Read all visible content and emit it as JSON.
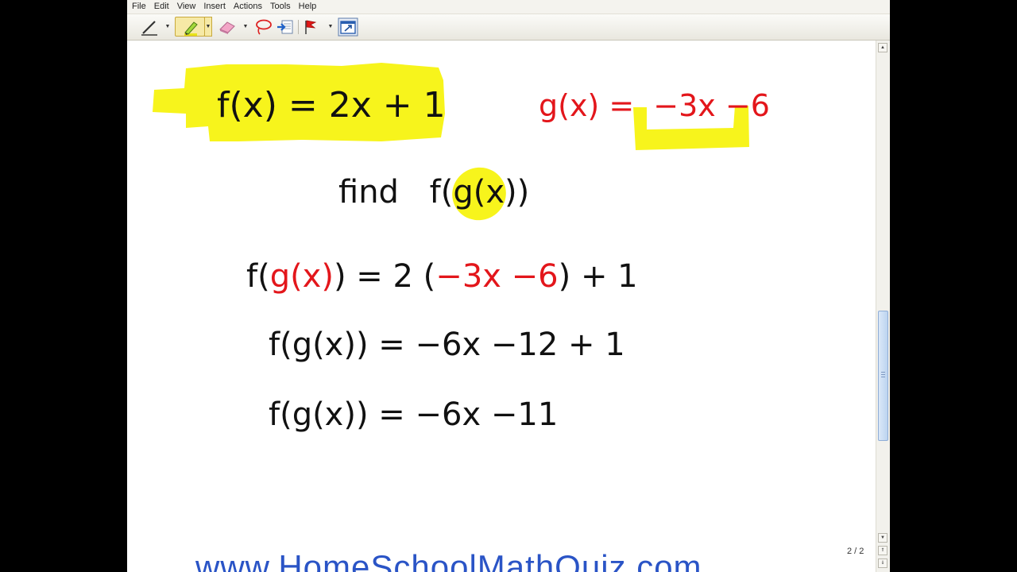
{
  "menu": {
    "items": [
      "File",
      "Edit",
      "View",
      "Insert",
      "Actions",
      "Tools",
      "Help"
    ]
  },
  "toolbar": {
    "tools": [
      {
        "name": "pen-tool",
        "icon": "pen-icon"
      },
      {
        "name": "highlighter-tool",
        "icon": "highlighter-icon",
        "selected": true
      },
      {
        "name": "eraser-tool",
        "icon": "eraser-icon"
      },
      {
        "name": "lasso-tool",
        "icon": "lasso-icon"
      },
      {
        "name": "insert-space-tool",
        "icon": "insert-space-icon"
      },
      {
        "name": "flag-tool",
        "icon": "flag-icon"
      },
      {
        "name": "full-screen-tool",
        "icon": "full-screen-icon"
      }
    ]
  },
  "notes": {
    "f_definition": "f(x) = 2x + 1",
    "g_label": "g(x) =",
    "g_expression": "−3x −6",
    "find_word": "find",
    "find_target_f": "f(",
    "find_target_g": "g(x)",
    "find_target_close": ")",
    "step1_lhs_f": "f(",
    "step1_lhs_g": "g(x)",
    "step1_mid": ") = 2 (",
    "step1_sub": "−3x −6",
    "step1_tail": ") + 1",
    "step2": "f(g(x)) = −6x −12 + 1",
    "step3": "f(g(x)) = −6x −11"
  },
  "colors": {
    "ink_black": "#111111",
    "ink_red": "#e3161b",
    "highlight_yellow": "#f7f41c",
    "website_blue": "#2a54c6"
  },
  "page_counter": "2 / 2",
  "website": "www.HomeSchoolMathQuiz.com"
}
